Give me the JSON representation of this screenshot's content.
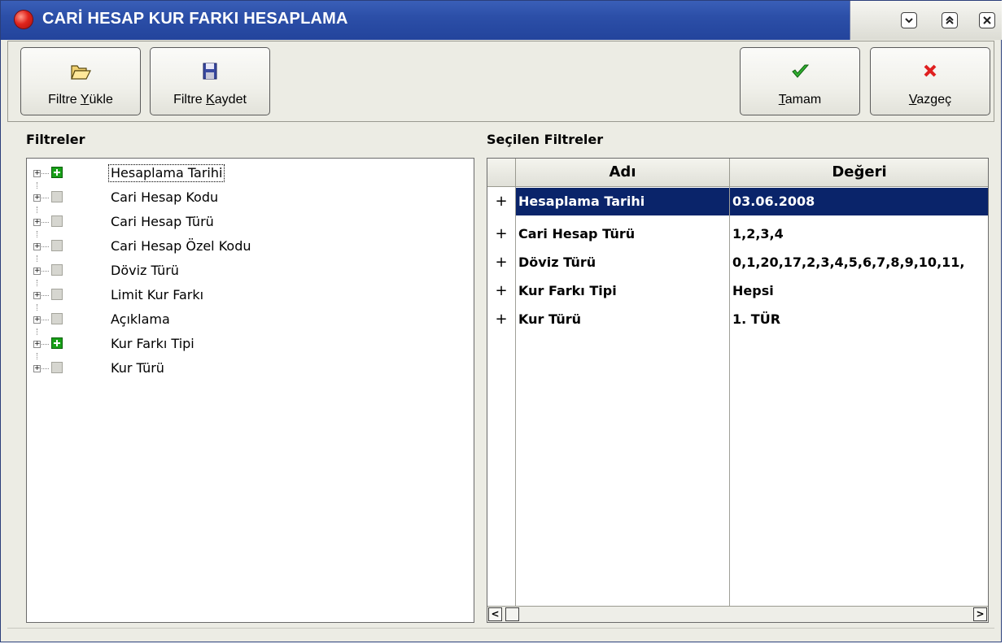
{
  "window": {
    "title": "CARİ HESAP KUR FARKI HESAPLAMA",
    "controls": [
      "minimize",
      "maximize",
      "close"
    ]
  },
  "toolbar": {
    "load_filter": {
      "label_pre": "Filtre ",
      "label_u": "Y",
      "label_post": "ükle",
      "icon": "folder-open-icon"
    },
    "save_filter": {
      "label_pre": "Filtre ",
      "label_u": "K",
      "label_post": "aydet",
      "icon": "floppy-disk-icon"
    },
    "ok": {
      "label_pre": "",
      "label_u": "T",
      "label_post": "amam",
      "icon": "checkmark-icon"
    },
    "cancel": {
      "label_pre": "",
      "label_u": "V",
      "label_post": "azgeç",
      "icon": "red-x-icon"
    }
  },
  "filters_panel": {
    "title": "Filtreler",
    "items": [
      {
        "label": "Hesaplama Tarihi",
        "checked": true,
        "selected": true
      },
      {
        "label": "Cari Hesap Kodu",
        "checked": false
      },
      {
        "label": "Cari Hesap Türü",
        "checked": false
      },
      {
        "label": "Cari Hesap Özel Kodu",
        "checked": false
      },
      {
        "label": "Döviz Türü",
        "checked": false
      },
      {
        "label": "Limit Kur Farkı",
        "checked": false
      },
      {
        "label": "Açıklama",
        "checked": false
      },
      {
        "label": "Kur Farkı Tipi",
        "checked": true
      },
      {
        "label": "Kur Türü",
        "checked": false
      }
    ]
  },
  "selected_panel": {
    "title": "Seçilen Filtreler",
    "columns": [
      "Adı",
      "Değeri"
    ],
    "rows": [
      {
        "mark": "+",
        "name": "Hesaplama Tarihi",
        "value": "03.06.2008",
        "selected": true
      },
      {
        "mark": "+",
        "name": "Cari Hesap Türü",
        "value": "1,2,3,4"
      },
      {
        "mark": "+",
        "name": "Döviz Türü",
        "value": "0,1,20,17,2,3,4,5,6,7,8,9,10,11,"
      },
      {
        "mark": "+",
        "name": "Kur Farkı Tipi",
        "value": "Hepsi"
      },
      {
        "mark": "+",
        "name": "Kur Türü",
        "value": "1. TÜR"
      }
    ]
  },
  "colors": {
    "titlebar": "#2c4fa8",
    "selection": "#0a246a",
    "checked_green": "#18a018"
  }
}
